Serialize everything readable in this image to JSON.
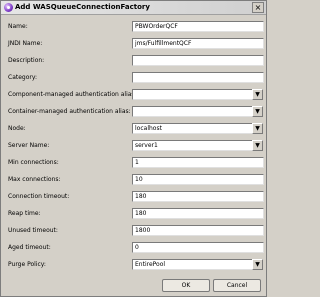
{
  "window": {
    "title": "Add WASQueueConnectionFactory",
    "close_glyph": "×"
  },
  "fields": [
    {
      "key": "name",
      "label": "Name:",
      "value": "PBWOrderQCF",
      "type": "text"
    },
    {
      "key": "jndi",
      "label": "JNDI Name:",
      "value": "jms/FulfillmentQCF",
      "type": "text"
    },
    {
      "key": "description",
      "label": "Description:",
      "value": "",
      "type": "text"
    },
    {
      "key": "category",
      "label": "Category:",
      "value": "",
      "type": "text"
    },
    {
      "key": "comp_auth",
      "label": "Component-managed authentication alias:",
      "value": "",
      "type": "combo"
    },
    {
      "key": "cont_auth",
      "label": "Container-managed authentication alias:",
      "value": "",
      "type": "combo"
    },
    {
      "key": "node",
      "label": "Node:",
      "value": "localhost",
      "type": "combo"
    },
    {
      "key": "server",
      "label": "Server Name:",
      "value": "server1",
      "type": "combo"
    },
    {
      "key": "min_conn",
      "label": "Min connections:",
      "value": "1",
      "type": "text"
    },
    {
      "key": "max_conn",
      "label": "Max connections:",
      "value": "10",
      "type": "text"
    },
    {
      "key": "conn_timeout",
      "label": "Connection timeout:",
      "value": "180",
      "type": "text"
    },
    {
      "key": "reap_time",
      "label": "Reap time:",
      "value": "180",
      "type": "text"
    },
    {
      "key": "unused_timeout",
      "label": "Unused timeout:",
      "value": "1800",
      "type": "text"
    },
    {
      "key": "aged_timeout",
      "label": "Aged timeout:",
      "value": "0",
      "type": "text"
    },
    {
      "key": "purge_policy",
      "label": "Purge Policy:",
      "value": "EntirePool",
      "type": "combo"
    }
  ],
  "buttons": {
    "ok": "OK",
    "cancel": "Cancel"
  }
}
